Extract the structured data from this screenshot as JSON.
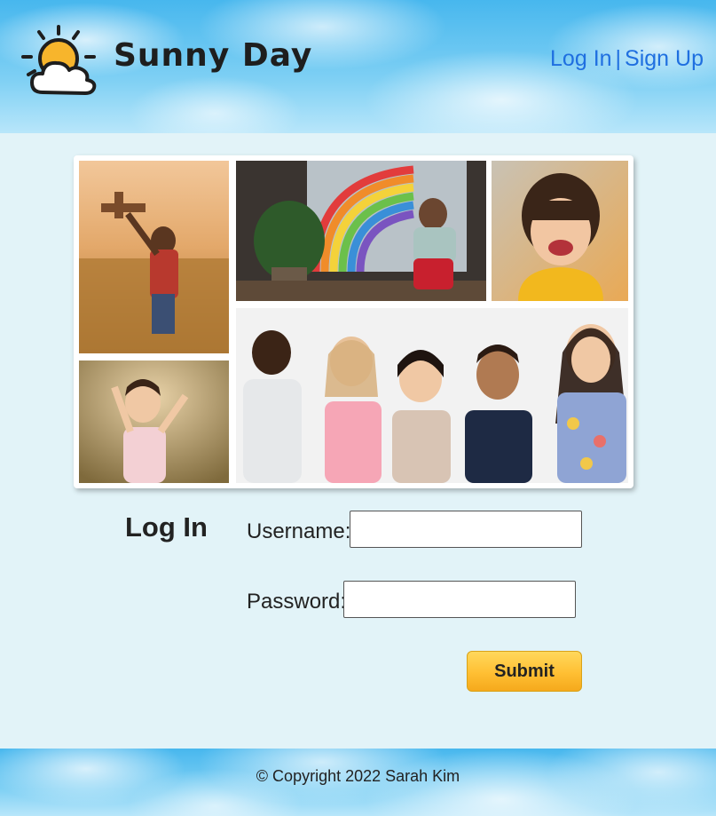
{
  "brand": {
    "name": "Sunny Day",
    "logo_icon": "sun-cloud-icon"
  },
  "nav": {
    "login": "Log In",
    "separator": "|",
    "signup": "Sign Up"
  },
  "colors": {
    "link": "#1f6fe0",
    "page_bg": "#e2f3f8",
    "button": "#ffbf33"
  },
  "login": {
    "title": "Log In",
    "username_label": "Username:",
    "username_value": "",
    "password_label": "Password:",
    "password_value": "",
    "submit_label": "Submit"
  },
  "footer": {
    "copyright": "© Copyright 2022 Sarah Kim"
  }
}
